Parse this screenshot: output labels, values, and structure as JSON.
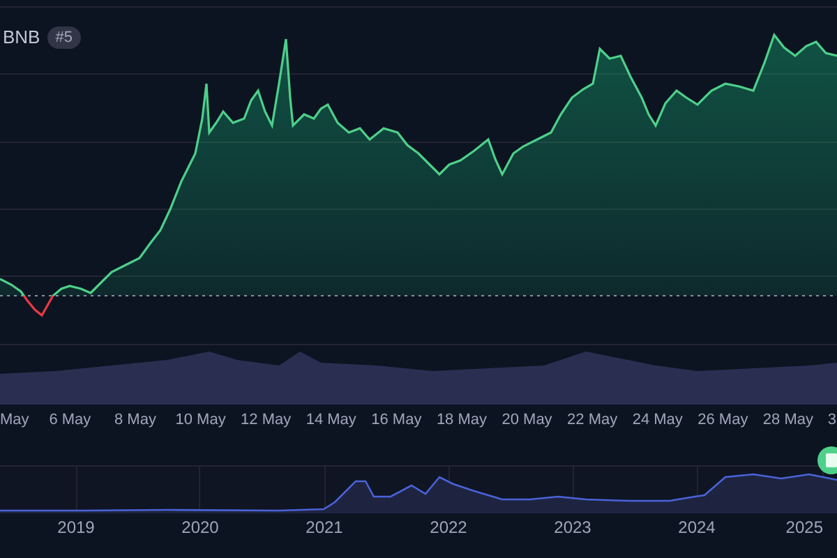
{
  "legend": {
    "symbol": "BNB",
    "rank": "#5"
  },
  "price_chart": {
    "x_labels": [
      "May",
      "6 May",
      "8 May",
      "10 May",
      "12 May",
      "14 May",
      "16 May",
      "18 May",
      "20 May",
      "22 May",
      "24 May",
      "26 May",
      "28 May",
      "3"
    ]
  },
  "navigator": {
    "year_labels": [
      "2019",
      "2020",
      "2021",
      "2022",
      "2023",
      "2024",
      "2025"
    ]
  }
}
